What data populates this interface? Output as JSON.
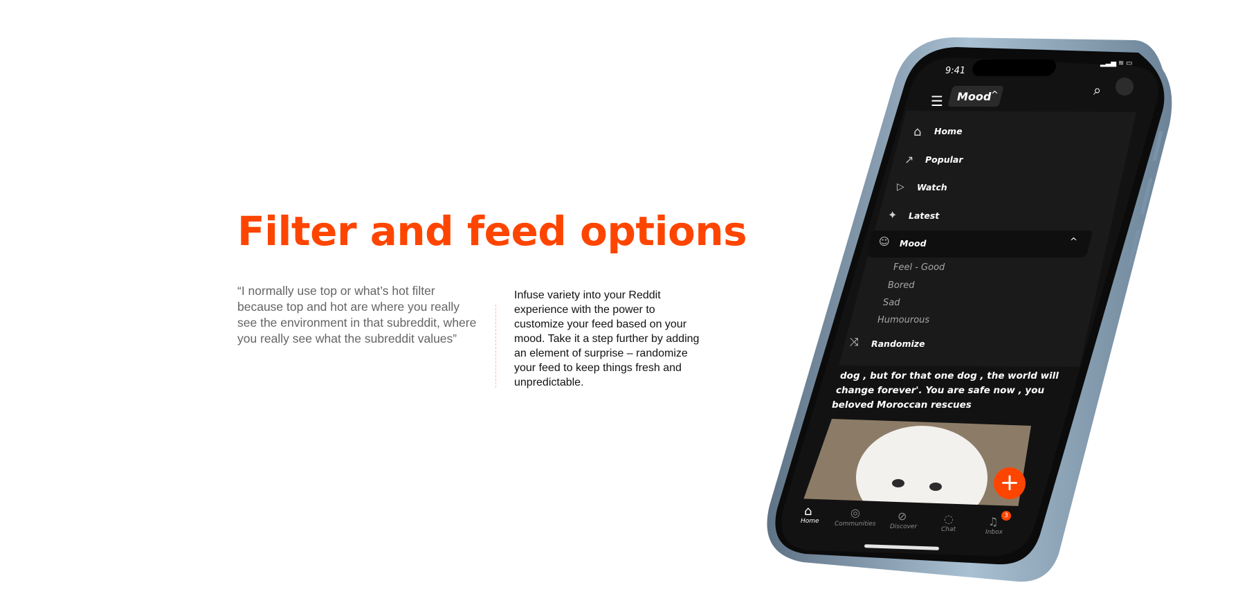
{
  "headline": "Filter and feed options",
  "quote": "“I normally use top or what’s hot filter because top and hot are where you really see the environment in that subreddit, where you really see what the subreddit values”",
  "description": "Infuse variety into your Reddit experience with the power to customize your feed based on your mood. Take it a step further by adding an element of surprise – randomize your feed to keep things fresh and unpredictable.",
  "phone": {
    "status_time": "9:41",
    "header_dropdown": "Mood",
    "menu": [
      {
        "label": "Home",
        "icon": "home-icon"
      },
      {
        "label": "Popular",
        "icon": "trending-arrow-icon"
      },
      {
        "label": "Watch",
        "icon": "play-icon"
      },
      {
        "label": "Latest",
        "icon": "sparkle-icon"
      },
      {
        "label": "Mood",
        "icon": "mood-face-icon",
        "selected": true
      }
    ],
    "mood_options": [
      "Feel - Good",
      "Bored",
      "Sad",
      "Humourous"
    ],
    "randomize_label": "Randomize",
    "post_text": [
      "dog , but for that one dog , the world will",
      "change forever'. You are safe now , you",
      "beloved Moroccan rescues"
    ],
    "nav": [
      {
        "label": "Home",
        "icon": "home-icon",
        "active": true
      },
      {
        "label": "Communities",
        "icon": "communities-icon"
      },
      {
        "label": "Discover",
        "icon": "compass-icon"
      },
      {
        "label": "Chat",
        "icon": "chat-icon"
      },
      {
        "label": "Inbox",
        "icon": "bell-icon",
        "badge": "3"
      }
    ],
    "colors": {
      "accent": "#fe4500",
      "frame": "#8fa8bd",
      "screen_bg": "#121212"
    }
  }
}
